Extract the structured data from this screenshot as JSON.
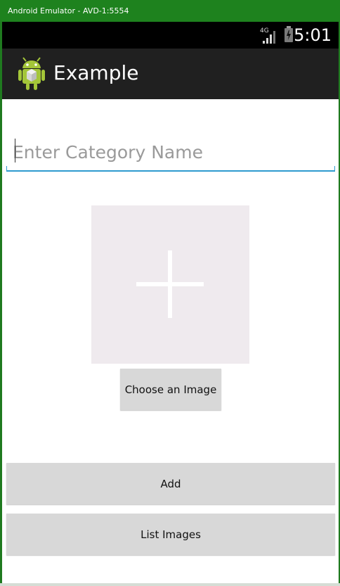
{
  "window": {
    "title": "Android Emulator - AVD-1:5554",
    "accent_color": "#1e821e"
  },
  "status_bar": {
    "network_label": "4G",
    "time": "5:01",
    "icons": [
      "network-icon",
      "battery-icon"
    ]
  },
  "action_bar": {
    "title": "Example",
    "icon": "android-icon"
  },
  "form": {
    "category_input": {
      "value": "",
      "placeholder": "Enter Category Name"
    },
    "image_placeholder": {
      "icon": "plus-icon"
    },
    "choose_image_label": "Choose an Image",
    "add_label": "Add",
    "list_images_label": "List Images"
  }
}
